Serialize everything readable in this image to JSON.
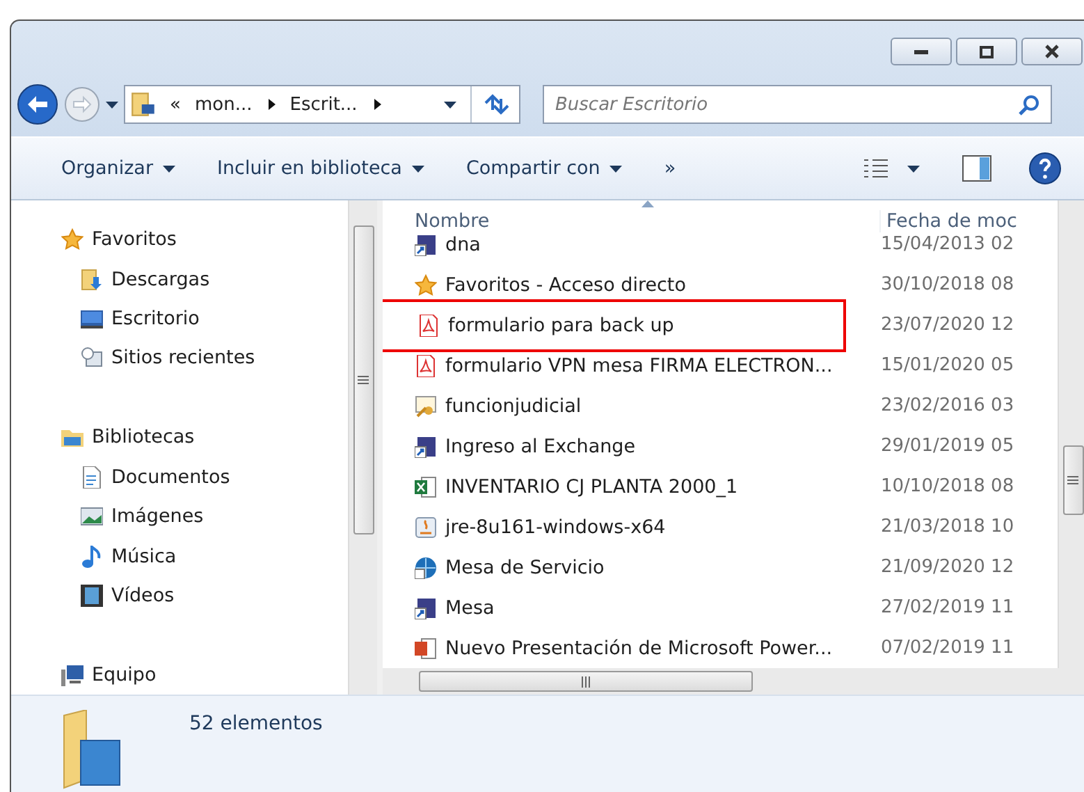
{
  "address": {
    "crumbs": [
      "«",
      "mon...",
      "Escrit..."
    ]
  },
  "search": {
    "placeholder": "Buscar Escritorio"
  },
  "toolbar": {
    "items": [
      {
        "label": "Organizar",
        "dropdown": true
      },
      {
        "label": "Incluir en biblioteca",
        "dropdown": true
      },
      {
        "label": "Compartir con",
        "dropdown": true
      },
      {
        "label": "»",
        "dropdown": false
      }
    ]
  },
  "sidebar": {
    "groups": [
      {
        "label": "Favoritos",
        "kind": "star",
        "children": [
          {
            "label": "Descargas",
            "kind": "downloads"
          },
          {
            "label": "Escritorio",
            "kind": "desktop"
          },
          {
            "label": "Sitios recientes",
            "kind": "recent"
          }
        ]
      },
      {
        "label": "Bibliotecas",
        "kind": "library",
        "children": [
          {
            "label": "Documentos",
            "kind": "document"
          },
          {
            "label": "Imágenes",
            "kind": "image"
          },
          {
            "label": "Música",
            "kind": "music"
          },
          {
            "label": "Vídeos",
            "kind": "video"
          }
        ]
      },
      {
        "label": "Equipo",
        "kind": "computer"
      }
    ]
  },
  "file_list": {
    "columns": [
      "Nombre",
      "Fecha de moc"
    ],
    "rows": [
      {
        "name": "dna",
        "date": "15/04/2013 02",
        "kind": "shortcut",
        "highlighted": false
      },
      {
        "name": "Favoritos - Acceso directo",
        "date": "30/10/2018 08",
        "kind": "star",
        "highlighted": false
      },
      {
        "name": "formulario para back up",
        "date": "23/07/2020 12",
        "kind": "pdf",
        "highlighted": true
      },
      {
        "name": "formulario VPN mesa  FIRMA ELECTRON...",
        "date": "15/01/2020 05",
        "kind": "pdf",
        "highlighted": false
      },
      {
        "name": "funcionjudicial",
        "date": "23/02/2016 03",
        "kind": "cert",
        "highlighted": false
      },
      {
        "name": "Ingreso al Exchange",
        "date": "29/01/2019 05",
        "kind": "shortcut",
        "highlighted": false
      },
      {
        "name": "INVENTARIO CJ PLANTA 2000_1",
        "date": "10/10/2018 08",
        "kind": "excel",
        "highlighted": false
      },
      {
        "name": "jre-8u161-windows-x64",
        "date": "21/03/2018 10",
        "kind": "java",
        "highlighted": false
      },
      {
        "name": "Mesa de Servicio",
        "date": "21/09/2020 12",
        "kind": "globe",
        "highlighted": false
      },
      {
        "name": "Mesa",
        "date": "27/02/2019 11",
        "kind": "shortcut",
        "highlighted": false
      },
      {
        "name": "Nuevo Presentación de Microsoft Power...",
        "date": "07/02/2019 11",
        "kind": "ppt",
        "highlighted": false
      }
    ]
  },
  "status_bar": {
    "text": "52 elementos"
  }
}
